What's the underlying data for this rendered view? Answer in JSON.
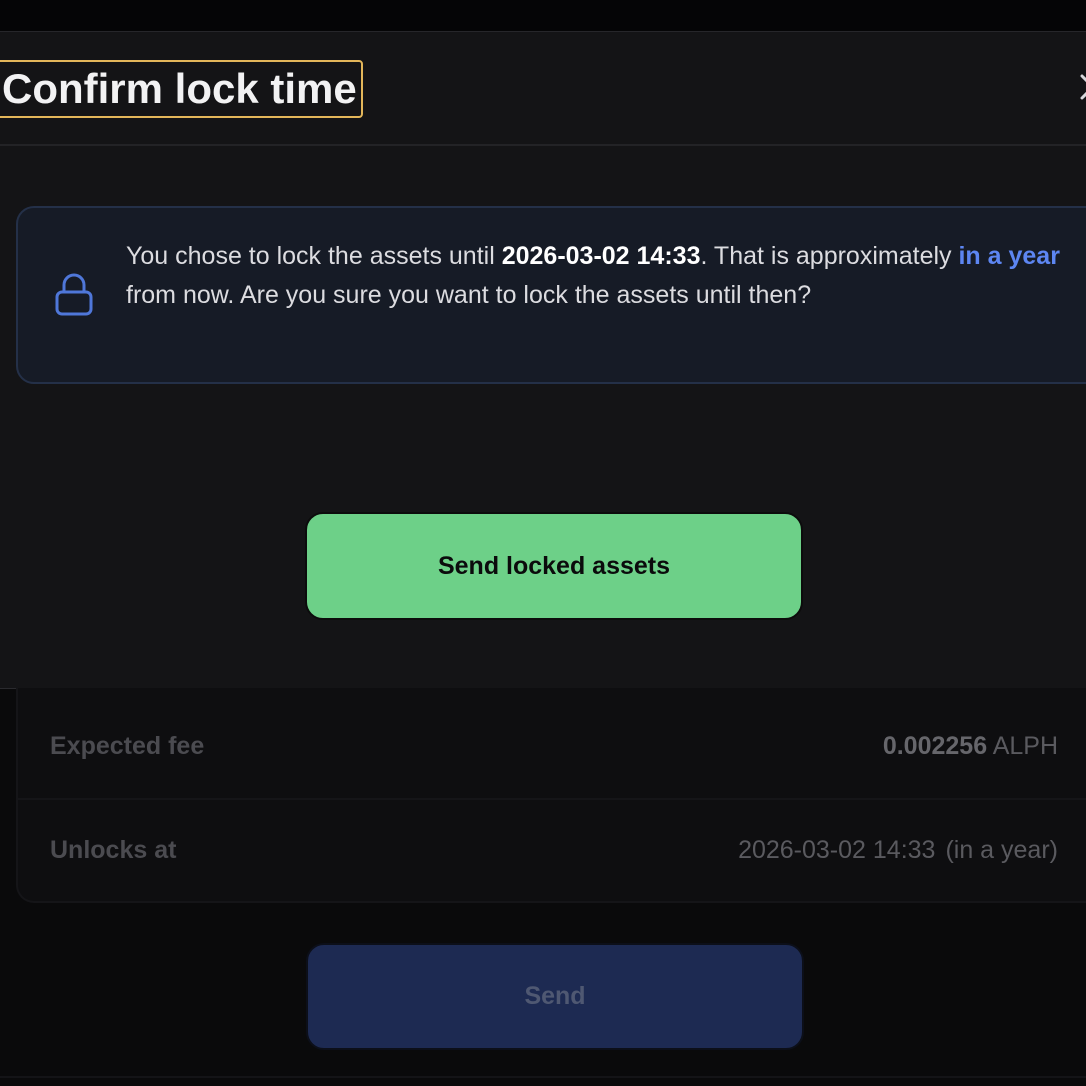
{
  "modal": {
    "title": "Confirm lock time",
    "info": {
      "text_before": "You chose to lock the assets until ",
      "unlock_datetime": "2026-03-02 14:33",
      "text_middle": ". That is approximately ",
      "relative_time": "in a year",
      "text_after": " from now. Are you sure you want to lock the assets until then?"
    },
    "confirm_button_label": "Send locked assets"
  },
  "details": {
    "expected_fee_label": "Expected fee",
    "expected_fee_amount": "0.002256",
    "expected_fee_unit": "ALPH",
    "unlocks_at_label": "Unlocks at",
    "unlocks_at_value": "2026-03-02 14:33",
    "unlocks_at_relative": "(in a year)"
  },
  "send_button_label": "Send",
  "colors": {
    "accent_blue": "#5d86f2",
    "confirm_green": "#6dd088",
    "title_highlight": "#e3b65a",
    "send_button_bg": "#1d2a52"
  },
  "icons": {
    "lock": "lock-icon",
    "close": "close-icon"
  }
}
